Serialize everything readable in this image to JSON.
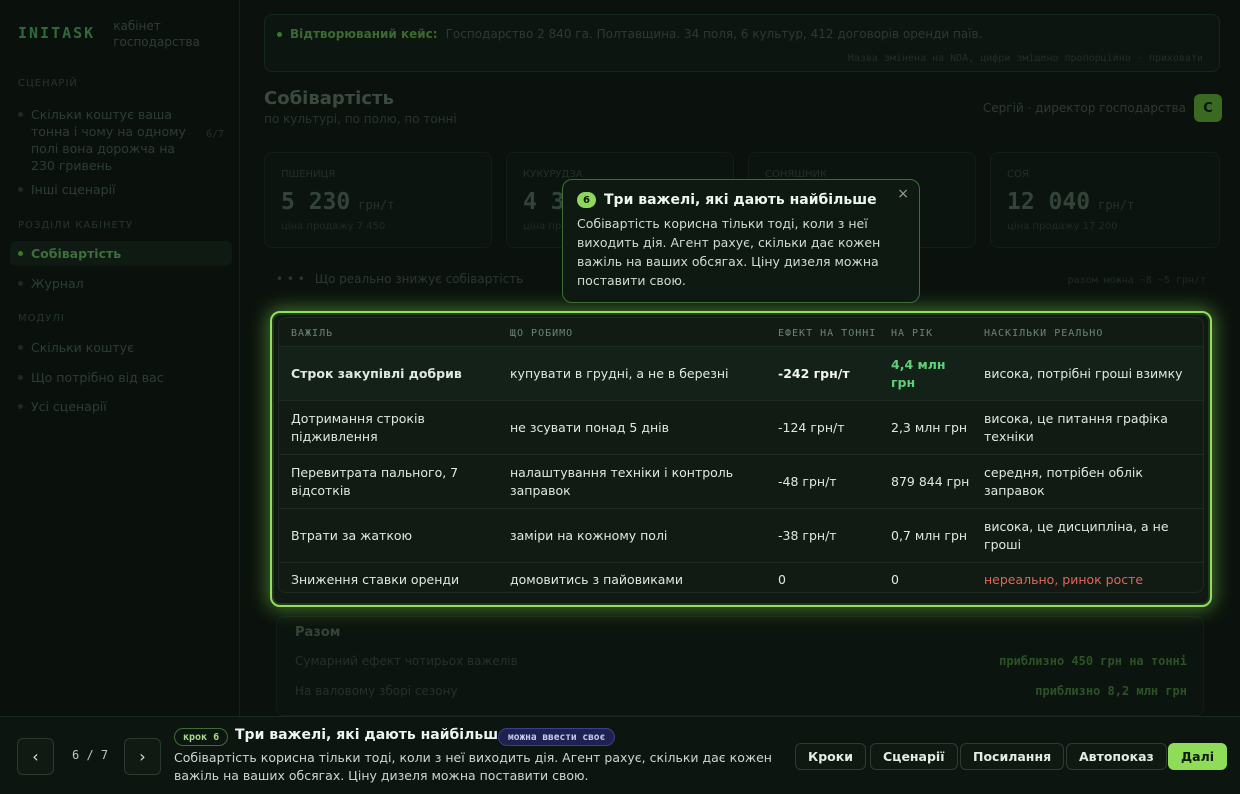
{
  "sidebar": {
    "brand": "INITASK",
    "brand_sub_1": "кабінет",
    "brand_sub_2": "господарства",
    "section_scenario": "СЦЕНАРІЙ",
    "scenario_item": "Скільки коштує ваша тонна і чому на одному полі вона дорожча на 230 гривень",
    "scenario_count": "6/7",
    "other_scenarios": "Інші сценарії",
    "section_views": "РОЗДІЛИ КАБІНЕТУ",
    "item_cost": "Собівартість",
    "item_journal": "Журнал",
    "section_modules": "МОДУЛІ",
    "item_price": "Скільки коштує",
    "item_need": "Що потрібно від вас",
    "item_all": "Усі сценарії"
  },
  "banner": {
    "label": "Відтворюваний кейс:",
    "text": "Господарство 2 840 га. Полтавщина. 34 поля, 6 культур, 412 договорів оренди паїв.",
    "note": "Назва змінена на NDA, цифри зміщено пропорційно · приховати"
  },
  "page": {
    "title": "Собівартість",
    "subtitle": "по культурі, по полю, по тонні",
    "user_name": "Сергій · директор господарства",
    "avatar_letter": "С"
  },
  "metrics": [
    {
      "label": "пшениця",
      "value": "5 230",
      "unit": "грн/т",
      "sub": "ціна продажу 7 450"
    },
    {
      "label": "кукурудза",
      "value": "4 3",
      "unit": "",
      "sub": "ціна пр"
    },
    {
      "label": "соняшник",
      "value": "",
      "unit": "",
      "sub": ""
    },
    {
      "label": "соя",
      "value": "12 040",
      "unit": "грн/т",
      "sub": "ціна продажу 17 200"
    }
  ],
  "section": {
    "label": "Що реально знижує собівартість",
    "meta": "разом можна ~8 ~5 грн/т"
  },
  "table": {
    "headers": [
      "ВАЖІЛЬ",
      "ЩО РОБИМО",
      "ЕФЕКТ НА ТОННІ",
      "НА РІК",
      "НАСКІЛЬКИ РЕАЛЬНО"
    ],
    "rows": [
      {
        "lever": "Строк закупівлі добрив",
        "action": "купувати в грудні, а не в березні",
        "effect": "-242 грн/т",
        "year": "4,4 млн грн",
        "realism": "висока, потрібні гроші взимку"
      },
      {
        "lever": "Дотримання строків підживлення",
        "action": "не зсувати понад 5 днів",
        "effect": "-124 грн/т",
        "year": "2,3 млн грн",
        "realism": "висока, це питання графіка техніки"
      },
      {
        "lever": "Перевитрата пального, 7 відсотків",
        "action": "налаштування техніки і контроль заправок",
        "effect": "-48 грн/т",
        "year": "879 844 грн",
        "realism": "середня, потрібен облік заправок"
      },
      {
        "lever": "Втрати за жаткою",
        "action": "заміри на кожному полі",
        "effect": "-38 грн/т",
        "year": "0,7 млн грн",
        "realism": "висока, це дисципліна, а не гроші"
      },
      {
        "lever": "Зниження ставки оренди",
        "action": "домовитись з пайовиками",
        "effect": "0",
        "year": "0",
        "realism": "нереально, ринок росте"
      }
    ],
    "colors": {
      "positive": "#5fd07a",
      "negative": "#e0665c"
    }
  },
  "summary": {
    "title": "Разом",
    "row1_label": "Сумарний ефект чотирьох важелів",
    "row1_value": "приблизно 450 грн на тонні",
    "row2_label": "На валовому зборі сезону",
    "row2_value": "приблизно 8,2 млн грн"
  },
  "tooltip": {
    "badge": "6",
    "title": "Три важелі, які дають найбільше",
    "body": "Собівартість корисна тільки тоді, коли з неї виходить дія. Агент рахує, скільки дає кожен важіль на ваших обсягах. Ціну дизеля можна поставити свою.",
    "close": "×"
  },
  "bottom": {
    "prev": "‹",
    "next": "›",
    "counter": "6 / 7",
    "step": "крок 6",
    "title": "Три важелі, які дають найбільше",
    "enter_badge": "можна ввести своє",
    "desc": "Собівартість корисна тільки тоді, коли з неї виходить дія. Агент рахує, скільки дає кожен важіль на ваших обсягах. Ціну дизеля можна поставити свою.",
    "btn_steps": "Кроки",
    "btn_scenarios": "Сценарії",
    "btn_links": "Посилання",
    "btn_autoplay": "Автопоказ",
    "btn_next": "Далі"
  },
  "accent_color": "#8fdc58"
}
